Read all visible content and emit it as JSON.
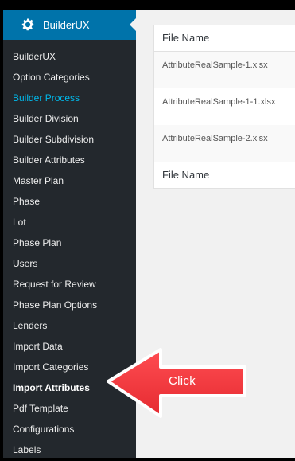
{
  "sidebar": {
    "header_title": "BuilderUX",
    "items": [
      {
        "label": "BuilderUX"
      },
      {
        "label": "Option Categories"
      },
      {
        "label": "Builder Process"
      },
      {
        "label": "Builder Division"
      },
      {
        "label": "Builder Subdivision"
      },
      {
        "label": "Builder Attributes"
      },
      {
        "label": "Master Plan"
      },
      {
        "label": "Phase"
      },
      {
        "label": "Lot"
      },
      {
        "label": "Phase Plan"
      },
      {
        "label": "Users"
      },
      {
        "label": "Request for Review"
      },
      {
        "label": "Phase Plan Options"
      },
      {
        "label": "Lenders"
      },
      {
        "label": "Import Data"
      },
      {
        "label": "Import Categories"
      },
      {
        "label": "Import Attributes"
      },
      {
        "label": "Pdf Template"
      },
      {
        "label": "Configurations"
      },
      {
        "label": "Labels"
      }
    ]
  },
  "colors": {
    "sidebar_bg": "#23282d",
    "header_bg": "#0073aa",
    "current_page_text": "#00b9eb",
    "callout_red": "#f0393e"
  },
  "table": {
    "header": "File Name",
    "footer": "File Name",
    "rows": [
      {
        "file": "AttributeRealSample-1.xlsx"
      },
      {
        "file": "AttributeRealSample-1-1.xlsx"
      },
      {
        "file": "AttributeRealSample-2.xlsx"
      }
    ]
  },
  "annotation": {
    "text": "Click"
  }
}
